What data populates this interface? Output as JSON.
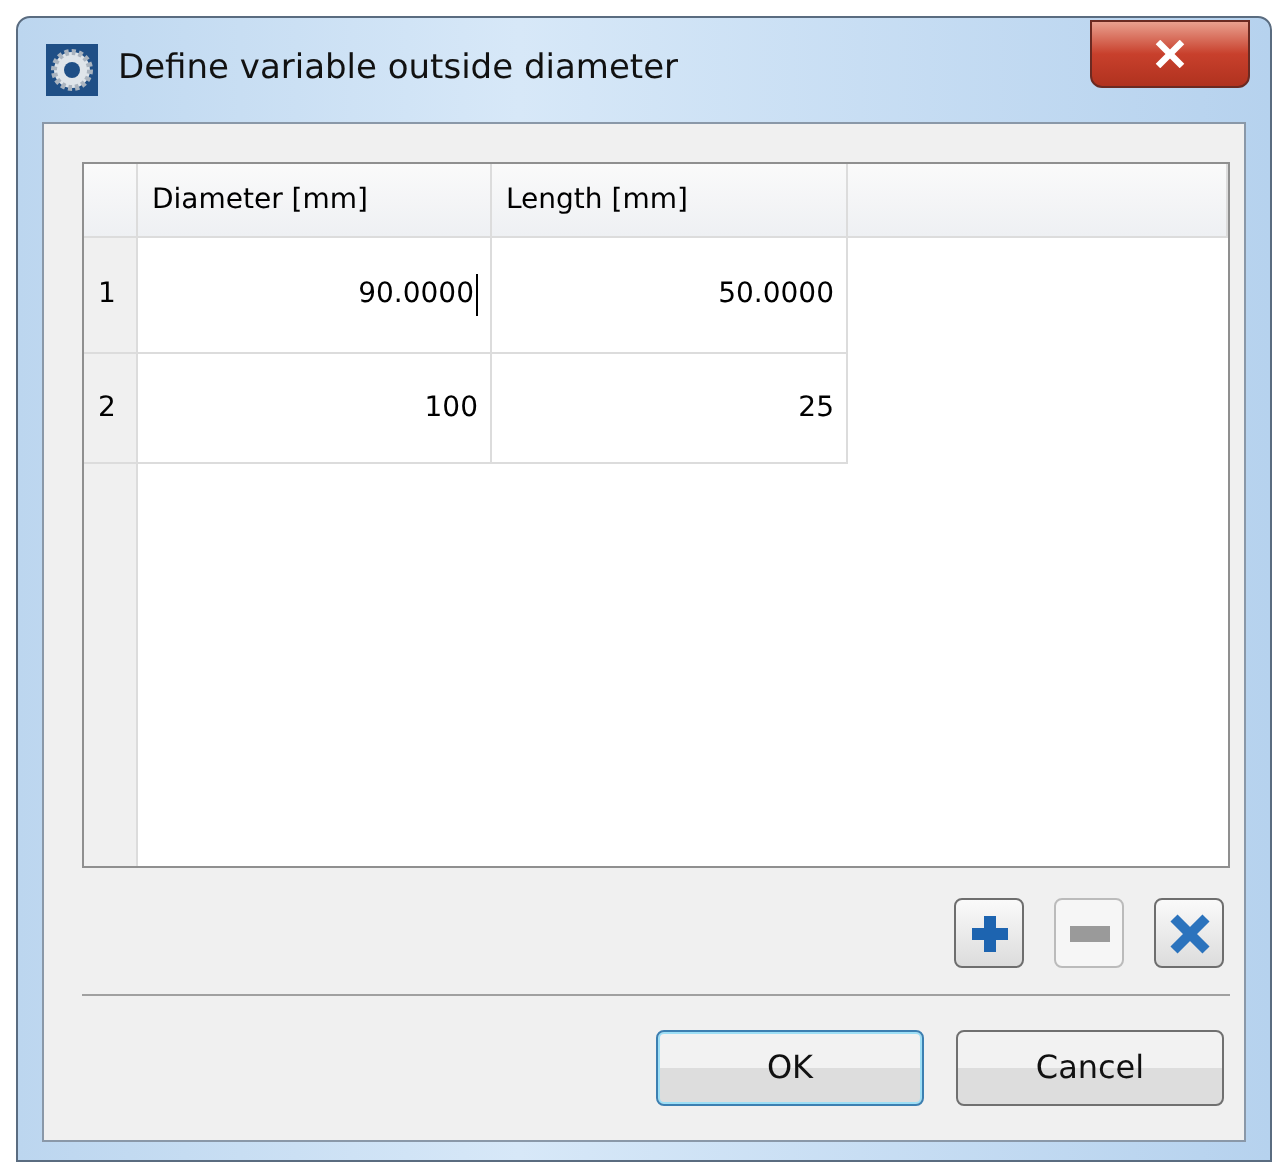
{
  "window": {
    "title": "Define variable outside diameter"
  },
  "table": {
    "columns": [
      "Diameter [mm]",
      "Length [mm]"
    ],
    "rows": [
      {
        "number": "1",
        "cells": [
          {
            "text": "90.0000",
            "editing": true
          },
          {
            "text": "50.0000",
            "editing": false
          }
        ]
      },
      {
        "number": "2",
        "cells": [
          {
            "text": "100",
            "editing": false
          },
          {
            "text": "25",
            "editing": false
          }
        ]
      }
    ]
  },
  "row_tools": [
    {
      "kind": "add",
      "disabled": false
    },
    {
      "kind": "remove",
      "disabled": true
    },
    {
      "kind": "delete",
      "disabled": false
    }
  ],
  "buttons": [
    {
      "label": "OK",
      "default": true
    },
    {
      "label": "Cancel",
      "default": false
    }
  ]
}
